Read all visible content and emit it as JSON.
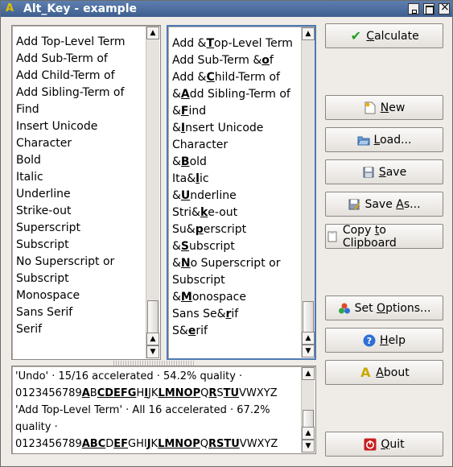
{
  "window": {
    "title": "Alt_Key - example"
  },
  "terms_list": [
    "Add Top-Level Term",
    "Add Sub-Term of",
    "Add Child-Term of",
    "Add Sibling-Term of",
    "Find",
    "Insert Unicode",
    "Character",
    "Bold",
    "Italic",
    "Underline",
    "Strike-out",
    "Superscript",
    "Subscript",
    "No Superscript or",
    "Subscript",
    "Monospace",
    "Sans Serif",
    "Serif"
  ],
  "accel_list": [
    [
      "Add &",
      "T",
      "op-Level Term"
    ],
    [
      "Add Sub-Term &",
      "o",
      "f"
    ],
    [
      "Add &",
      "C",
      "hild-Term of"
    ],
    [
      "&",
      "A",
      "dd Sibling-Term of"
    ],
    [
      "&",
      "F",
      "ind"
    ],
    [
      "&",
      "I",
      "nsert Unicode"
    ],
    [
      "Character",
      "",
      ""
    ],
    [
      "&",
      "B",
      "old"
    ],
    [
      "Ita&",
      "l",
      "ic"
    ],
    [
      "&",
      "U",
      "nderline"
    ],
    [
      "Stri&",
      "k",
      "e-out"
    ],
    [
      "Su&",
      "p",
      "erscript"
    ],
    [
      "&",
      "S",
      "ubscript"
    ],
    [
      "&",
      "N",
      "o Superscript or"
    ],
    [
      "Subscript",
      "",
      ""
    ],
    [
      "&",
      "M",
      "onospace"
    ],
    [
      "Sans Se&",
      "r",
      "if"
    ],
    [
      "S&",
      "e",
      "rif"
    ]
  ],
  "log": {
    "line1": "'Undo' · 15/16 accelerated · 54.2% quality ·",
    "line2": [
      [
        "0123456789",
        0
      ],
      [
        "A",
        1
      ],
      [
        "B",
        0
      ],
      [
        "CDEFG",
        1
      ],
      [
        "H",
        0
      ],
      [
        "I",
        1
      ],
      [
        "JK",
        0
      ],
      [
        "LMNOP",
        1
      ],
      [
        "Q",
        0
      ],
      [
        "R",
        1
      ],
      [
        "S",
        0
      ],
      [
        "TU",
        1
      ],
      [
        "VWXYZ",
        0
      ]
    ],
    "line3": "'Add Top-Level Term' · All 16 accelerated · 67.2%",
    "line4": "quality ·",
    "line5": [
      [
        "0123456789",
        0
      ],
      [
        "ABC",
        1
      ],
      [
        "D",
        0
      ],
      [
        "EF",
        1
      ],
      [
        "GHI",
        0
      ],
      [
        "J",
        1
      ],
      [
        "K",
        0
      ],
      [
        "LMNOP",
        1
      ],
      [
        "Q",
        0
      ],
      [
        "RSTU",
        1
      ],
      [
        "VWXYZ",
        0
      ]
    ]
  },
  "buttons": {
    "calculate": [
      "",
      "C",
      "alculate"
    ],
    "new": [
      "",
      "N",
      "ew"
    ],
    "load": [
      "",
      "L",
      "oad..."
    ],
    "save": [
      "",
      "S",
      "ave"
    ],
    "save_as": [
      "Save ",
      "A",
      "s..."
    ],
    "copy": [
      "Copy ",
      "t",
      "o Clipboard"
    ],
    "set_options": [
      "Set ",
      "O",
      "ptions..."
    ],
    "help": [
      "",
      "H",
      "elp"
    ],
    "about": [
      "",
      "A",
      "bout"
    ],
    "quit": [
      "",
      "Q",
      "uit"
    ]
  },
  "colors": {
    "titlebar": "#4a6c9e",
    "focus": "#4d79b2",
    "check": "#22a022",
    "help": "#2d6fd6",
    "quit": "#c81e1e"
  },
  "icons": {
    "calculate": "check-icon",
    "new": "new-document-icon",
    "load": "folder-open-icon",
    "save": "floppy-disk-icon",
    "save_as": "floppy-disk-icon",
    "copy": "clipboard-icon",
    "set_options": "color-palette-icon",
    "help": "help-icon",
    "about": "app-logo-icon",
    "quit": "power-icon"
  }
}
